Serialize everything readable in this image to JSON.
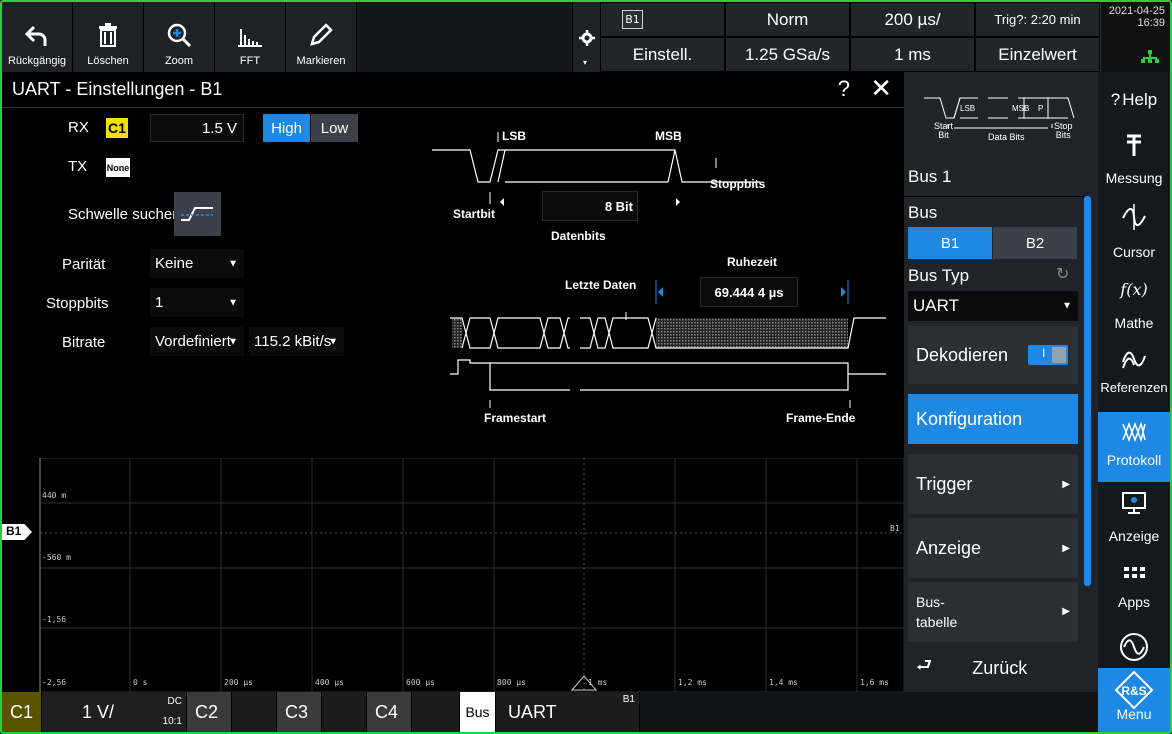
{
  "toolbar": {
    "items": [
      {
        "label": "Rückgängig",
        "icon": "undo-icon"
      },
      {
        "label": "Löschen",
        "icon": "trash-icon"
      },
      {
        "label": "Zoom",
        "icon": "zoom-icon"
      },
      {
        "label": "FFT",
        "icon": "fft-icon"
      },
      {
        "label": "Markieren",
        "icon": "pencil-icon"
      }
    ]
  },
  "header": {
    "b1": "B1",
    "norm": "Norm",
    "timebase": "200 µs/",
    "trig": "Trig?: 2:20 min",
    "einstell": "Einstell.",
    "samplerate": "1.25 GSa/s",
    "record": "1 ms",
    "einzelwert": "Einzelwert",
    "date": "2021-04-25",
    "time": "16:39"
  },
  "dialog": {
    "title": "UART - Einstellungen - B1",
    "help": "?",
    "close": "✕",
    "rx_label": "RX",
    "rx_channel": "C1",
    "rx_level": "1.5 V",
    "high": "High",
    "low": "Low",
    "tx_label": "TX",
    "tx_channel": "None",
    "find_threshold": "Schwelle suchen",
    "parity_label": "Parität",
    "parity_value": "Keine",
    "stopbits_label": "Stoppbits",
    "stopbits_value": "1",
    "bitrate_label": "Bitrate",
    "bitrate_mode": "Vordefiniert",
    "bitrate_value": "115.2 kBit/s",
    "diagram": {
      "lsb": "LSB",
      "msb": "MSB",
      "stoppbits": "Stoppbits",
      "startbit": "Startbit",
      "databits_value": "8 Bit",
      "databits": "Datenbits",
      "ruhezeit": "Ruhezeit",
      "letzte_daten": "Letzte Daten",
      "idle_value": "69.444 4 µs",
      "framestart": "Framestart",
      "frame_ende": "Frame-Ende"
    }
  },
  "waveform": {
    "channel_marker": "B1",
    "right_label": "B1",
    "y_labels": [
      "440 m",
      "-560 m",
      "-1,56",
      "-2,56"
    ],
    "x_labels": [
      "0 s",
      "200 µs",
      "400 µs",
      "600 µs",
      "800 µs",
      "1 ms",
      "1,2 ms",
      "1,4 ms",
      "1,6 ms"
    ]
  },
  "right_panel": {
    "diagram": {
      "start": "Start\nBit",
      "data": "Data Bits",
      "stop": "Stop\nBits",
      "lsb": "LSB",
      "msb": "MSB",
      "p": "P"
    },
    "bus_title": "Bus 1",
    "bus_label": "Bus",
    "b1": "B1",
    "b2": "B2",
    "bus_type_label": "Bus Typ",
    "bus_type_value": "UART",
    "decode": "Dekodieren",
    "toggle": "I",
    "config": "Konfiguration",
    "trigger": "Trigger",
    "anzeige": "Anzeige",
    "bustable": "Bus-\ntabelle",
    "back": "Zurück"
  },
  "sidebar": {
    "help": "Help",
    "measure": "Messung",
    "cursor": "Cursor",
    "math": "Mathe",
    "refs": "Referenzen",
    "protocol": "Protokoll",
    "display": "Anzeige",
    "apps": "Apps",
    "menu": "Menu"
  },
  "bottom": {
    "c1": "C1",
    "c1_scale": "1 V/",
    "c1_dc": "DC",
    "c1_ratio": "10:1",
    "c2": "C2",
    "c3": "C3",
    "c4": "C4",
    "bus": "Bus",
    "bus_type": "UART",
    "bus_id": "B1"
  },
  "colors": {
    "accent": "#1e88e5",
    "c1": "#f2e100",
    "frame": "#2ecc40"
  }
}
